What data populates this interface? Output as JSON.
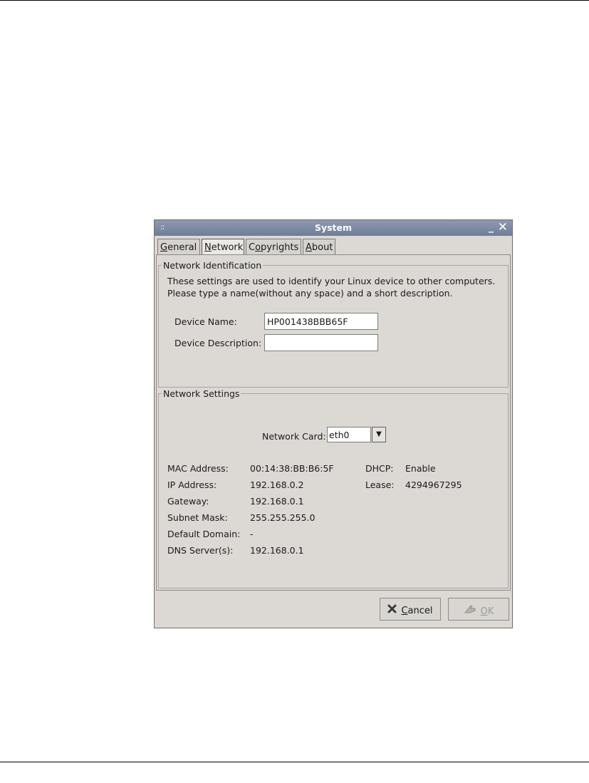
{
  "window": {
    "title": "System",
    "grip": "::"
  },
  "tabs": [
    {
      "label": "General",
      "mnemonic": "G",
      "rest": "eneral"
    },
    {
      "label": "Network",
      "mnemonic": "N",
      "rest": "etwork"
    },
    {
      "label": "Copyrights",
      "pre": "C",
      "mnemonic": "o",
      "rest": "pyrights"
    },
    {
      "label": "About",
      "mnemonic": "A",
      "rest": "bout"
    }
  ],
  "identification": {
    "title": "Network Identification",
    "desc_line1": "These settings are used to identify your Linux device to other computers.",
    "desc_line2": "Please type a name(without any space) and a short description.",
    "device_name_label": "Device Name:",
    "device_name_value": "HP001438BBB65F",
    "device_desc_label": "Device Description:",
    "device_desc_value": ""
  },
  "settings": {
    "title": "Network Settings",
    "card_label": "Network Card:",
    "card_value": "eth0",
    "rows": [
      {
        "label": "MAC Address:",
        "value": "00:14:38:BB:B6:5F"
      },
      {
        "label": "IP Address:",
        "value": "192.168.0.2"
      },
      {
        "label": "Gateway:",
        "value": "192.168.0.1"
      },
      {
        "label": "Subnet Mask:",
        "value": "255.255.255.0"
      },
      {
        "label": "Default Domain:",
        "value": "-"
      },
      {
        "label": "DNS Server(s):",
        "value": "192.168.0.1"
      }
    ],
    "dhcp_label": "DHCP:",
    "dhcp_value": "Enable",
    "lease_label": "Lease:",
    "lease_value": "4294967295"
  },
  "buttons": {
    "cancel": {
      "mnemonic": "C",
      "rest": "ancel",
      "icon": "x-icon"
    },
    "ok": {
      "mnemonic": "O",
      "rest": "K",
      "icon": "hand-icon"
    }
  }
}
